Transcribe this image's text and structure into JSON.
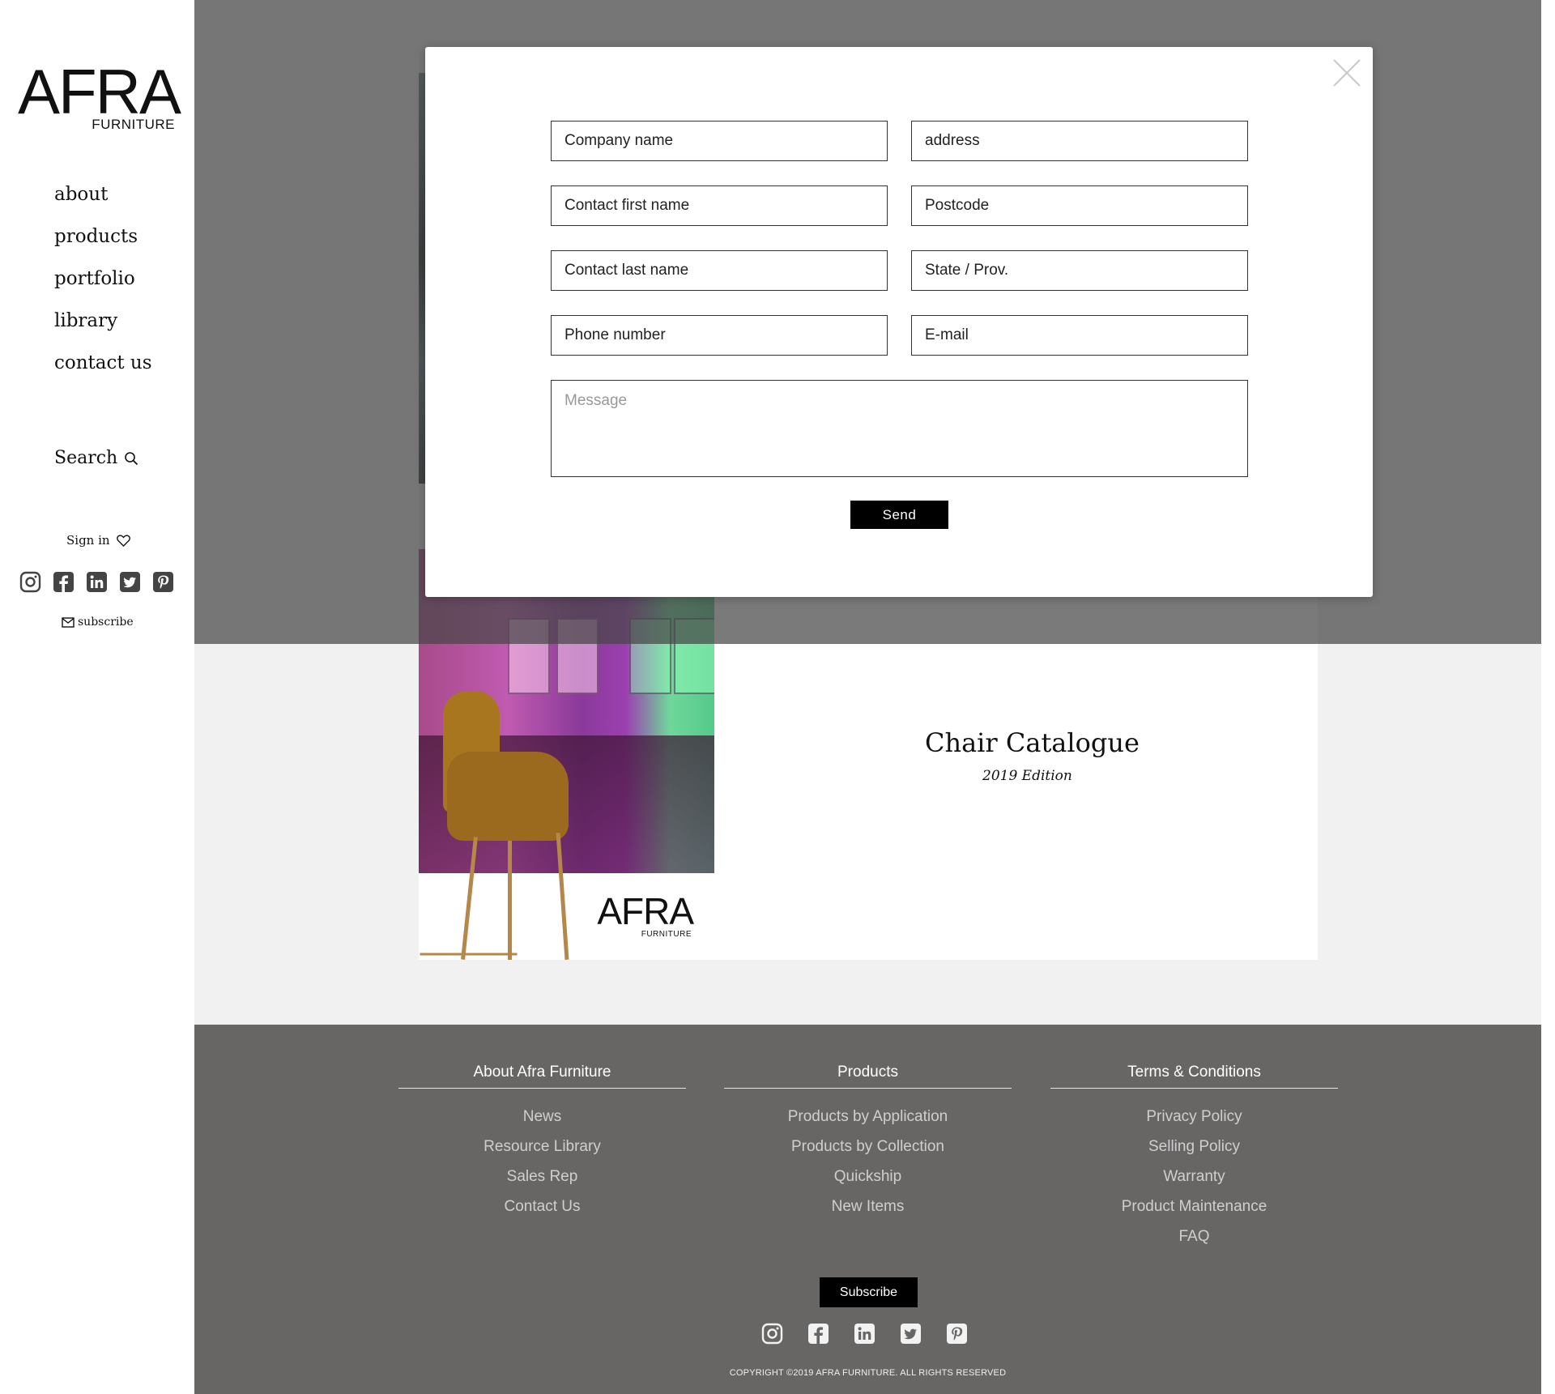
{
  "brand": {
    "name": "AFRA",
    "sub": "FURNITURE"
  },
  "sidebar": {
    "nav": [
      {
        "label": "about"
      },
      {
        "label": "products"
      },
      {
        "label": "portfolio"
      },
      {
        "label": "library"
      },
      {
        "label": "contact us"
      }
    ],
    "search_label": "Search",
    "signin_label": "Sign in",
    "subscribe_label": "subscribe",
    "social": [
      "instagram-icon",
      "facebook-icon",
      "linkedin-icon",
      "twitter-icon",
      "pinterest-icon"
    ]
  },
  "catalog": {
    "title": "Chair Catalogue",
    "subtitle": "2019 Edition",
    "cover_brand": "AFRA",
    "cover_brand_sub": "FURNITURE"
  },
  "modal": {
    "fields": {
      "company_name": "Company name",
      "address": "address",
      "contact_first_name": "Contact first name",
      "postcode": "Postcode",
      "contact_last_name": "Contact last name",
      "state_prov": "State / Prov.",
      "phone_number": "Phone number",
      "email": "E-mail",
      "message": "Message"
    },
    "send_label": "Send"
  },
  "footer": {
    "columns": [
      {
        "heading": "About Afra Furniture",
        "links": [
          "News",
          "Resource Library",
          "Sales Rep",
          "Contact Us"
        ]
      },
      {
        "heading": "Products",
        "links": [
          "Products by Application",
          "Products by Collection",
          "Quickship",
          "New Items"
        ]
      },
      {
        "heading": "Terms & Conditions",
        "links": [
          "Privacy Policy",
          "Selling Policy",
          "Warranty",
          "Product Maintenance",
          "FAQ"
        ]
      }
    ],
    "subscribe_label": "Subscribe",
    "social": [
      "instagram-icon",
      "facebook-icon",
      "linkedin-icon",
      "twitter-icon",
      "pinterest-icon"
    ],
    "copyright": "COPYRIGHT ©2019 AFRA FURNITURE. ALL RIGHTS RESERVED"
  },
  "colors": {
    "footer_bg": "#686565",
    "overlay": "#4a4a4a",
    "button": "#000000"
  }
}
